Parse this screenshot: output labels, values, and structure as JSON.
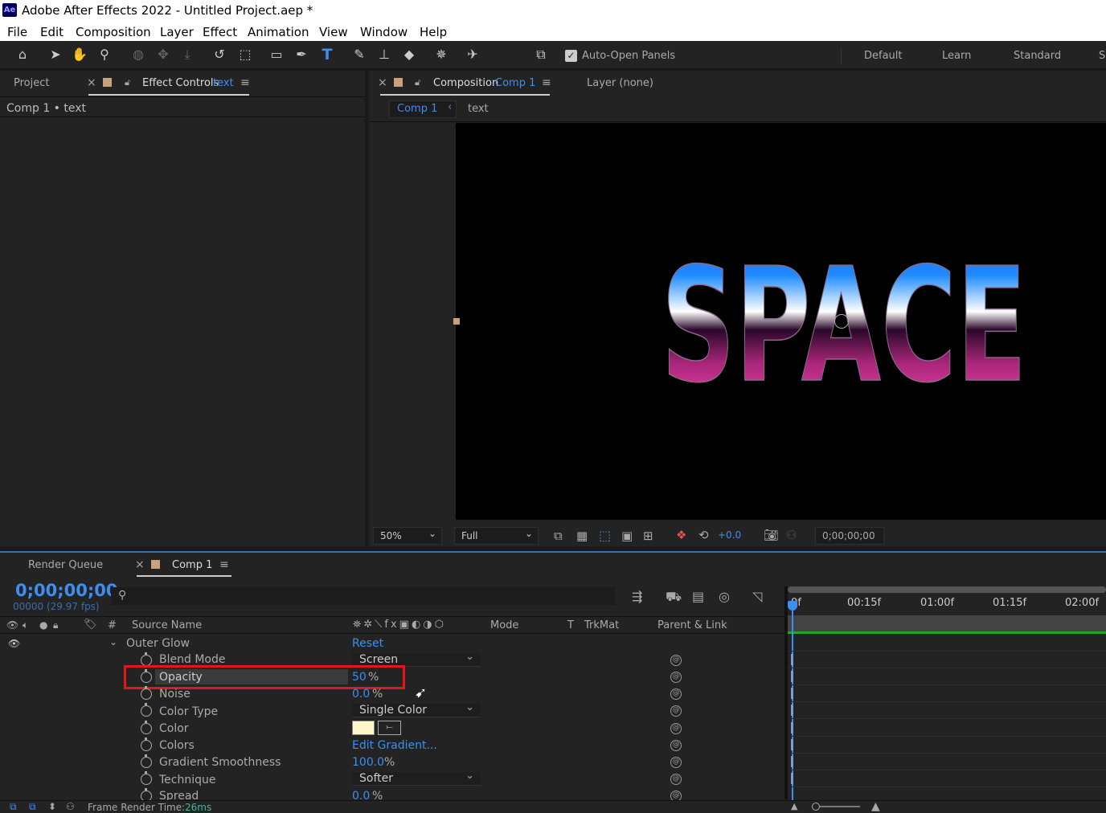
{
  "window": {
    "app_icon": "Ae",
    "title": "Adobe After Effects 2022 - Untitled Project.aep *"
  },
  "menu": [
    "File",
    "Edit",
    "Composition",
    "Layer",
    "Effect",
    "Animation",
    "View",
    "Window",
    "Help"
  ],
  "toolbar": {
    "auto_open_label": "Auto-Open Panels",
    "workspaces": [
      "Default",
      "Learn",
      "Standard",
      "S"
    ],
    "icons": [
      "home-icon",
      "selection-arrow-icon",
      "hand-icon",
      "zoom-icon",
      "orbit-icon",
      "pan-icon",
      "dolly-icon",
      "rotate-icon",
      "anchor-icon",
      "rectangle-icon",
      "pen-icon",
      "type-icon",
      "brush-icon",
      "clone-stamp-icon",
      "eraser-icon",
      "roto-brush-icon",
      "puppet-pin-icon",
      "snap-icon"
    ]
  },
  "left_panel": {
    "tab_project": "Project",
    "tab_effect_controls": "Effect Controls",
    "effect_controls_layer": "text",
    "breadcrumb": "Comp 1 • text"
  },
  "viewer": {
    "tab_composition": "Composition",
    "composition_name": "Comp 1",
    "tab_layer": "Layer (none)",
    "nav_comp": "Comp 1",
    "nav_layer": "text",
    "canvas_text": "SPACE",
    "zoom": "50%",
    "resolution": "Full",
    "exposure": "+0.0",
    "timecode": "0;00;00;00"
  },
  "timeline": {
    "tab_render_queue": "Render Queue",
    "tab_comp": "Comp 1",
    "timecode": "0;00;00;00",
    "frame_info": "00000 (29.97 fps)",
    "search_placeholder": "",
    "columns": {
      "num": "#",
      "source": "Source Name",
      "mode": "Mode",
      "t": "T",
      "trkmat": "TrkMat",
      "parent": "Parent & Link"
    },
    "ruler": [
      "0f",
      "00:15f",
      "01:00f",
      "01:15f",
      "02:00f"
    ],
    "effect_name": "Outer Glow",
    "effect_reset": "Reset",
    "properties": [
      {
        "name": "Blend Mode",
        "type": "dropdown",
        "value": "Screen"
      },
      {
        "name": "Opacity",
        "type": "number",
        "value": "50",
        "unit": "%",
        "highlighted": true
      },
      {
        "name": "Noise",
        "type": "number",
        "value": "0.0",
        "unit": "%"
      },
      {
        "name": "Color Type",
        "type": "dropdown",
        "value": "Single Color"
      },
      {
        "name": "Color",
        "type": "color",
        "value": ""
      },
      {
        "name": "Colors",
        "type": "link",
        "value": "Edit Gradient..."
      },
      {
        "name": "Gradient Smoothness",
        "type": "number",
        "value": "100.0",
        "unit": "%"
      },
      {
        "name": "Technique",
        "type": "dropdown",
        "value": "Softer"
      },
      {
        "name": "Spread",
        "type": "number",
        "value": "0.0",
        "unit": "%"
      }
    ],
    "status_label": "Frame Render Time:",
    "status_value": "26ms"
  },
  "colors": {
    "accent": "#3d8ef0",
    "highlight_box": "#e3151d",
    "swatch": "#fff8c8",
    "worktrack": "#23a623"
  }
}
